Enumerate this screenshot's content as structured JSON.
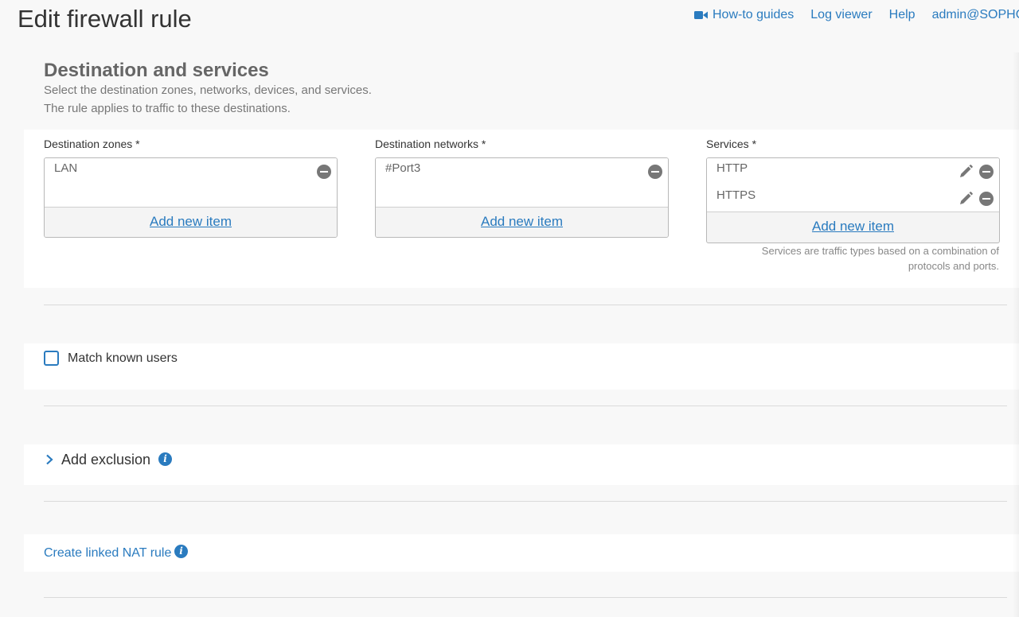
{
  "header": {
    "title": "Edit firewall rule",
    "nav": {
      "howto": "How-to guides",
      "logviewer": "Log viewer",
      "help": "Help",
      "user": "admin@SOPHOS"
    }
  },
  "section": {
    "heading": "Destination and services",
    "desc1": "Select the destination zones, networks, devices, and services.",
    "desc2": "The rule applies to traffic to these destinations."
  },
  "dest_zones": {
    "label": "Destination zones *",
    "items": [
      "LAN"
    ],
    "add_label": "Add new item"
  },
  "dest_networks": {
    "label": "Destination networks *",
    "items": [
      "#Port3"
    ],
    "add_label": "Add new item"
  },
  "services": {
    "label": "Services *",
    "items": [
      "HTTP",
      "HTTPS"
    ],
    "add_label": "Add new item",
    "help_line1": "Services are traffic types based on a combination of",
    "help_line2": "protocols and ports."
  },
  "match_users": {
    "label": "Match known users",
    "checked": false
  },
  "exclusion": {
    "label": "Add exclusion"
  },
  "nat": {
    "label": "Create linked NAT rule"
  },
  "colors": {
    "link": "#2a7bbf",
    "icon_gray": "#777777",
    "background": "#f8f8f8"
  }
}
